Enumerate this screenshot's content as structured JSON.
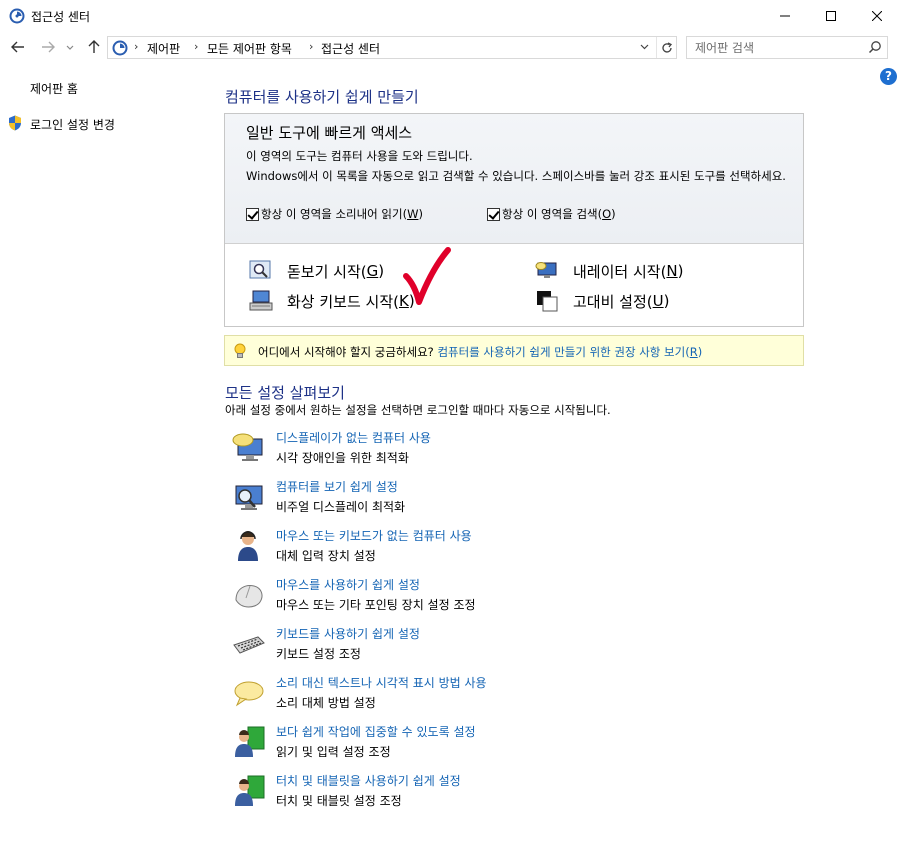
{
  "window": {
    "title": "접근성 센터",
    "controls": {
      "minimize": "—",
      "maximize": "☐",
      "close": "✕"
    }
  },
  "nav": {
    "back": "←",
    "forward": "→",
    "recent": "⌄",
    "up": "↑",
    "breadcrumb": [
      "제어판",
      "모든 제어판 항목",
      "접근성 센터"
    ],
    "separator": "›",
    "search_placeholder": "제어판 검색"
  },
  "sidebar": {
    "items": [
      {
        "label": "제어판 홈"
      },
      {
        "label": "로그인 설정 변경"
      }
    ]
  },
  "help": "?",
  "main": {
    "heading": "컴퓨터를 사용하기 쉽게 만들기",
    "quick": {
      "title": "일반 도구에 빠르게 액세스",
      "desc1": "이 영역의 도구는 컴퓨터 사용을 도와 드립니다.",
      "desc2": "Windows에서 이 목록을 자동으로 읽고 검색할 수 있습니다. 스페이스바를 눌러 강조 표시된 도구를 선택하세요.",
      "check1": {
        "label": "항상 이 영역을 소리내어 읽기(",
        "key": "W",
        "end": ")"
      },
      "check2": {
        "label": "항상 이 영역을 검색(",
        "key": "O",
        "end": ")"
      },
      "tools": [
        {
          "label": "돋보기 시작(",
          "key": "G",
          "end": ")"
        },
        {
          "label": "내레이터 시작(",
          "key": "N",
          "end": ")"
        },
        {
          "label": "화상 키보드 시작(",
          "key": "K",
          "end": ")"
        },
        {
          "label": "고대비 설정(",
          "key": "U",
          "end": ")"
        }
      ]
    },
    "tip": {
      "text": "어디에서 시작해야 할지 궁금하세요?",
      "link": "컴퓨터를 사용하기 쉽게 만들기 위한 권장 사항 보기(",
      "key": "R",
      "end": ")"
    },
    "explore": {
      "heading": "모든 설정 살펴보기",
      "subtitle": "아래 설정 중에서 원하는 설정을 선택하면 로그인할 때마다 자동으로 시작됩니다.",
      "items": [
        {
          "link": "디스플레이가 없는 컴퓨터 사용",
          "desc": "시각 장애인을 위한 최적화",
          "icon": "monitor-speech-icon"
        },
        {
          "link": "컴퓨터를 보기 쉽게 설정",
          "desc": "비주얼 디스플레이 최적화",
          "icon": "monitor-magnifier-icon"
        },
        {
          "link": "마우스 또는 키보드가 없는 컴퓨터 사용",
          "desc": "대체 입력 장치 설정",
          "icon": "person-headset-icon"
        },
        {
          "link": "마우스를 사용하기 쉽게 설정",
          "desc": "마우스 또는 기타 포인팅 장치 설정 조정",
          "icon": "mouse-icon"
        },
        {
          "link": "키보드를 사용하기 쉽게 설정",
          "desc": "키보드 설정 조정",
          "icon": "keyboard-icon"
        },
        {
          "link": "소리 대신 텍스트나 시각적 표시 방법 사용",
          "desc": "소리 대체 방법 설정",
          "icon": "speech-bubble-icon"
        },
        {
          "link": "보다 쉽게 작업에 집중할 수 있도록 설정",
          "desc": "읽기 및 입력 설정 조정",
          "icon": "users-icon"
        },
        {
          "link": "터치 및 태블릿을 사용하기 쉽게 설정",
          "desc": "터치 및 태블릿 설정 조정",
          "icon": "users-touch-icon"
        }
      ]
    }
  },
  "colors": {
    "link": "#1464b4",
    "heading": "#1e3287",
    "tip_bg": "#ffffd9",
    "annotation_check": "#e0002a"
  }
}
